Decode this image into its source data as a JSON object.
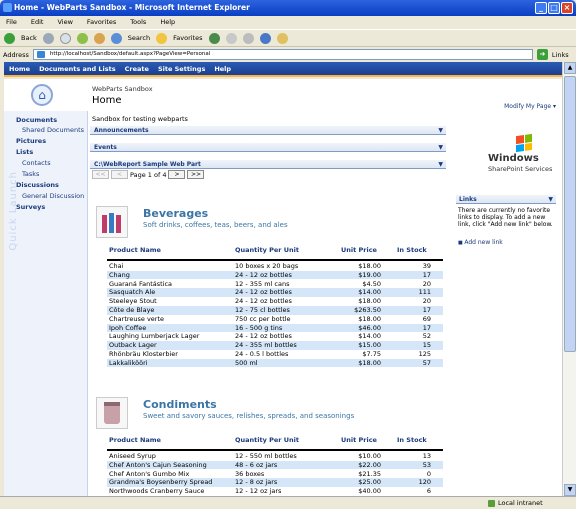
{
  "window": {
    "title": "Home - WebParts Sandbox - Microsoft Internet Explorer"
  },
  "menu": [
    "File",
    "Edit",
    "View",
    "Favorites",
    "Tools",
    "Help"
  ],
  "toolbar": {
    "back": "Back",
    "search": "Search",
    "favorites": "Favorites"
  },
  "address": {
    "label": "Address",
    "url": "http://localhost/Sandbox/default.aspx?PageView=Personal",
    "go": "Go",
    "links": "Links"
  },
  "topnav": [
    "Home",
    "Documents and Lists",
    "Create",
    "Site Settings",
    "Help"
  ],
  "header": {
    "site_name": "WebParts Sandbox",
    "page_title": "Home",
    "modify": "Modify My Page ▾"
  },
  "quicklaunch": {
    "watermark": "Quick Launch",
    "sections": [
      {
        "label": "Documents",
        "items": [
          "Shared Documents"
        ]
      },
      {
        "label": "Pictures",
        "items": []
      },
      {
        "label": "Lists",
        "items": [
          "Contacts",
          "Tasks"
        ]
      },
      {
        "label": "Discussions",
        "items": [
          "General Discussion"
        ]
      },
      {
        "label": "Surveys",
        "items": []
      }
    ]
  },
  "main": {
    "description": "Sandbox for testing webparts",
    "webparts": [
      "Announcements",
      "Events",
      "C:\\WebReport Sample Web Part"
    ],
    "pager": {
      "first": "<<",
      "prev": "<",
      "text": "Page 1 of 4",
      "next": ">",
      "last": ">>"
    },
    "columns": [
      "Product Name",
      "Quantity Per Unit",
      "Unit Price",
      "In Stock"
    ],
    "categories": [
      {
        "name": "Beverages",
        "description": "Soft drinks, coffees, teas, beers, and ales",
        "rows": [
          [
            "Chai",
            "10 boxes x 20 bags",
            "$18.00",
            "39"
          ],
          [
            "Chang",
            "24 - 12 oz bottles",
            "$19.00",
            "17"
          ],
          [
            "Guaraná Fantástica",
            "12 - 355 ml cans",
            "$4.50",
            "20"
          ],
          [
            "Sasquatch Ale",
            "24 - 12 oz bottles",
            "$14.00",
            "111"
          ],
          [
            "Steeleye Stout",
            "24 - 12 oz bottles",
            "$18.00",
            "20"
          ],
          [
            "Côte de Blaye",
            "12 - 75 cl bottles",
            "$263.50",
            "17"
          ],
          [
            "Chartreuse verte",
            "750 cc per bottle",
            "$18.00",
            "69"
          ],
          [
            "Ipoh Coffee",
            "16 - 500 g tins",
            "$46.00",
            "17"
          ],
          [
            "Laughing Lumberjack Lager",
            "24 - 12 oz bottles",
            "$14.00",
            "52"
          ],
          [
            "Outback Lager",
            "24 - 355 ml bottles",
            "$15.00",
            "15"
          ],
          [
            "Rhönbräu Klosterbier",
            "24 - 0.5 l bottles",
            "$7.75",
            "125"
          ],
          [
            "Lakkalikööri",
            "500 ml",
            "$18.00",
            "57"
          ]
        ]
      },
      {
        "name": "Condiments",
        "description": "Sweet and savory sauces, relishes, spreads, and seasonings",
        "rows": [
          [
            "Aniseed Syrup",
            "12 - 550 ml bottles",
            "$10.00",
            "13"
          ],
          [
            "Chef Anton's Cajun Seasoning",
            "48 - 6 oz jars",
            "$22.00",
            "53"
          ],
          [
            "Chef Anton's Gumbo Mix",
            "36 boxes",
            "$21.35",
            "0"
          ],
          [
            "Grandma's Boysenberry Spread",
            "12 - 8 oz jars",
            "$25.00",
            "120"
          ],
          [
            "Northwoods Cranberry Sauce",
            "12 - 12 oz jars",
            "$40.00",
            "6"
          ]
        ]
      }
    ]
  },
  "right": {
    "logo_windows": "Windows",
    "logo_sharepoint": "SharePoint Services",
    "links_title": "Links",
    "no_links": "There are currently no favorite links to display. To add a new link, click \"Add new link\" below.",
    "add_link": "Add new link"
  },
  "status": {
    "zone": "Local intranet"
  }
}
